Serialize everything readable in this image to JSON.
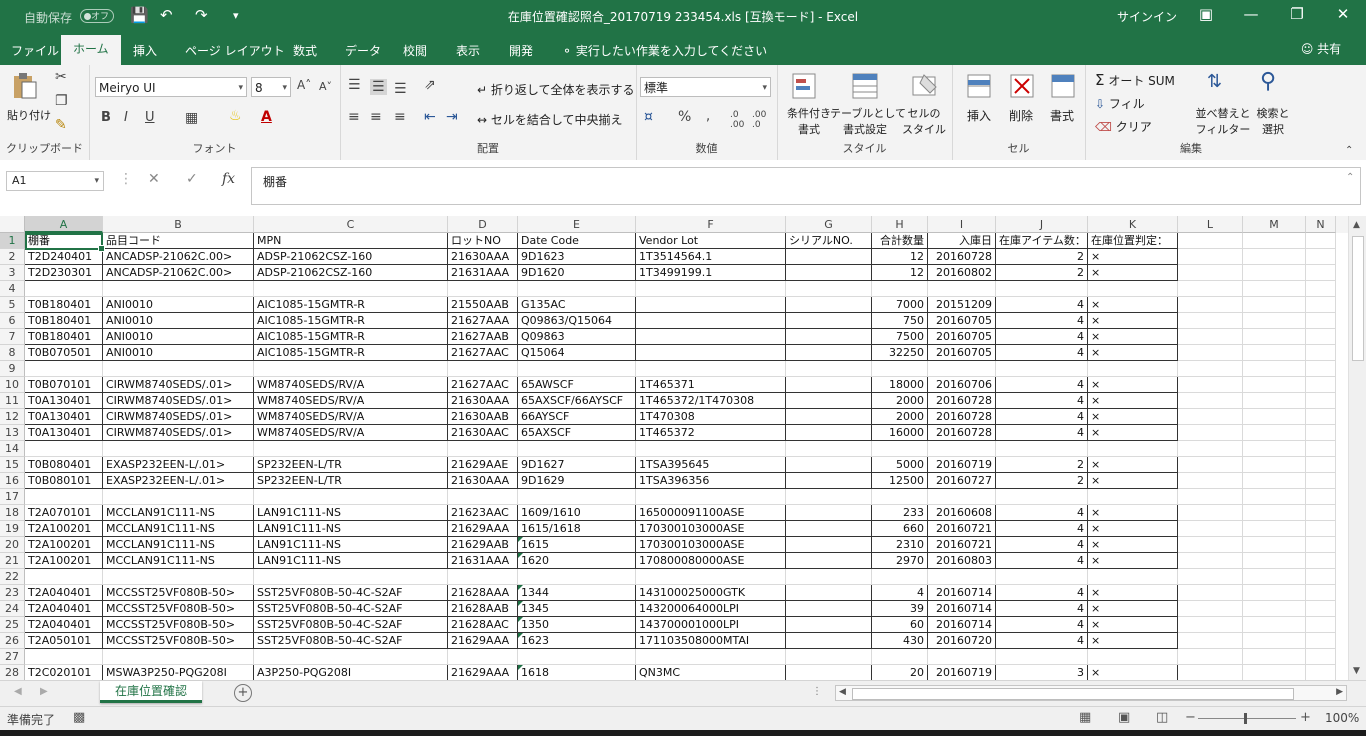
{
  "titlebar": {
    "autosave_label": "自動保存",
    "autosave_state": "オフ",
    "title": "在庫位置確認照合_20170719 233454.xls  [互換モード]  -  Excel",
    "signin": "サインイン",
    "icons": [
      "save-icon",
      "undo-icon",
      "redo-icon",
      "customize-icon",
      "ribbon-display-icon",
      "minimize-icon",
      "restore-icon",
      "close-icon"
    ]
  },
  "ribbon_tabs": {
    "items": [
      "ファイル",
      "ホーム",
      "挿入",
      "ページ レイアウト",
      "数式",
      "データ",
      "校閲",
      "表示",
      "開発"
    ],
    "active": "ホーム",
    "tell_me": "実行したい作業を入力してください",
    "share": "共有"
  },
  "ribbon": {
    "clipboard": {
      "label": "クリップボード",
      "paste": "貼り付け"
    },
    "font": {
      "label": "フォント",
      "name": "Meiryo UI",
      "size": "8"
    },
    "alignment": {
      "label": "配置",
      "wrap": "折り返して全体を表示する",
      "merge": "セルを結合して中央揃え"
    },
    "number": {
      "label": "数値",
      "format": "標準"
    },
    "styles": {
      "label": "スタイル",
      "cond_format": [
        "条件付き",
        "書式"
      ],
      "as_table": [
        "テーブルとして",
        "書式設定"
      ],
      "cell_styles": [
        "セルの",
        "スタイル"
      ]
    },
    "cells": {
      "label": "セル",
      "insert": "挿入",
      "delete": "削除",
      "format": "書式"
    },
    "editing": {
      "label": "編集",
      "autosum": "オート SUM",
      "fill": "フィル",
      "clear": "クリア",
      "sort": [
        "並べ替えと",
        "フィルター"
      ],
      "find": [
        "検索と",
        "選択"
      ]
    }
  },
  "formula_bar": {
    "name_box": "A1",
    "formula": "棚番"
  },
  "columns": [
    "A",
    "B",
    "C",
    "D",
    "E",
    "F",
    "G",
    "H",
    "I",
    "J",
    "K",
    "L",
    "M",
    "N"
  ],
  "rows": [
    {
      "n": "1",
      "c": [
        "棚番",
        "品目コード",
        "MPN",
        "ロットNO",
        "Date Code",
        "Vendor Lot",
        "シリアルNO.",
        "合計数量",
        "入庫日",
        "在庫アイテム数：",
        "在庫位置判定："
      ]
    },
    {
      "n": "2",
      "c": [
        "T2D240401",
        "ANCADSP-21062C.00>",
        "ADSP-21062CSZ-160",
        "21630AAA",
        "9D1623",
        "1T3514564.1",
        "",
        "12",
        "20160728",
        "2",
        "×"
      ]
    },
    {
      "n": "3",
      "c": [
        "T2D230301",
        "ANCADSP-21062C.00>",
        "ADSP-21062CSZ-160",
        "21631AAA",
        "9D1620",
        "1T3499199.1",
        "",
        "12",
        "20160802",
        "2",
        "×"
      ]
    },
    {
      "n": "4",
      "c": []
    },
    {
      "n": "5",
      "c": [
        "T0B180401",
        "ANI0010",
        "AIC1085-15GMTR-R",
        "21550AAB",
        "G135AC",
        "",
        "",
        "7000",
        "20151209",
        "4",
        "×"
      ]
    },
    {
      "n": "6",
      "c": [
        "T0B180401",
        "ANI0010",
        "AIC1085-15GMTR-R",
        "21627AAA",
        "Q09863/Q15064",
        "",
        "",
        "750",
        "20160705",
        "4",
        "×"
      ]
    },
    {
      "n": "7",
      "c": [
        "T0B180401",
        "ANI0010",
        "AIC1085-15GMTR-R",
        "21627AAB",
        "Q09863",
        "",
        "",
        "7500",
        "20160705",
        "4",
        "×"
      ]
    },
    {
      "n": "8",
      "c": [
        "T0B070501",
        "ANI0010",
        "AIC1085-15GMTR-R",
        "21627AAC",
        "Q15064",
        "",
        "",
        "32250",
        "20160705",
        "4",
        "×"
      ]
    },
    {
      "n": "9",
      "c": []
    },
    {
      "n": "10",
      "c": [
        "T0B070101",
        "CIRWM8740SEDS/.01>",
        "WM8740SEDS/RV/A",
        "21627AAC",
        "65AWSCF",
        "1T465371",
        "",
        "18000",
        "20160706",
        "4",
        "×"
      ]
    },
    {
      "n": "11",
      "c": [
        "T0A130401",
        "CIRWM8740SEDS/.01>",
        "WM8740SEDS/RV/A",
        "21630AAA",
        "65AXSCF/66AYSCF",
        "1T465372/1T470308",
        "",
        "2000",
        "20160728",
        "4",
        "×"
      ]
    },
    {
      "n": "12",
      "c": [
        "T0A130401",
        "CIRWM8740SEDS/.01>",
        "WM8740SEDS/RV/A",
        "21630AAB",
        "66AYSCF",
        "1T470308",
        "",
        "2000",
        "20160728",
        "4",
        "×"
      ]
    },
    {
      "n": "13",
      "c": [
        "T0A130401",
        "CIRWM8740SEDS/.01>",
        "WM8740SEDS/RV/A",
        "21630AAC",
        "65AXSCF",
        "1T465372",
        "",
        "16000",
        "20160728",
        "4",
        "×"
      ]
    },
    {
      "n": "14",
      "c": []
    },
    {
      "n": "15",
      "c": [
        "T0B080401",
        "EXASP232EEN-L/.01>",
        "SP232EEN-L/TR",
        "21629AAE",
        "9D1627",
        "1TSA395645",
        "",
        "5000",
        "20160719",
        "2",
        "×"
      ]
    },
    {
      "n": "16",
      "c": [
        "T0B080101",
        "EXASP232EEN-L/.01>",
        "SP232EEN-L/TR",
        "21630AAA",
        "9D1629",
        "1TSA396356",
        "",
        "12500",
        "20160727",
        "2",
        "×"
      ]
    },
    {
      "n": "17",
      "c": []
    },
    {
      "n": "18",
      "c": [
        "T2A070101",
        "MCCLAN91C111-NS",
        "LAN91C111-NS",
        "21623AAC",
        "1609/1610",
        "165000091100ASE",
        "",
        "233",
        "20160608",
        "4",
        "×"
      ]
    },
    {
      "n": "19",
      "c": [
        "T2A100201",
        "MCCLAN91C111-NS",
        "LAN91C111-NS",
        "21629AAA",
        "1615/1618",
        "170300103000ASE",
        "",
        "660",
        "20160721",
        "4",
        "×"
      ]
    },
    {
      "n": "20",
      "c": [
        "T2A100201",
        "MCCLAN91C111-NS",
        "LAN91C111-NS",
        "21629AAB",
        "1615",
        "170300103000ASE",
        "",
        "2310",
        "20160721",
        "4",
        "×"
      ]
    },
    {
      "n": "21",
      "c": [
        "T2A100201",
        "MCCLAN91C111-NS",
        "LAN91C111-NS",
        "21631AAA",
        "1620",
        "170800080000ASE",
        "",
        "2970",
        "20160803",
        "4",
        "×"
      ]
    },
    {
      "n": "22",
      "c": []
    },
    {
      "n": "23",
      "c": [
        "T2A040401",
        "MCCSST25VF080B-50>",
        "SST25VF080B-50-4C-S2AF",
        "21628AAA",
        "1344",
        "143100025000GTK",
        "",
        "4",
        "20160714",
        "4",
        "×"
      ]
    },
    {
      "n": "24",
      "c": [
        "T2A040401",
        "MCCSST25VF080B-50>",
        "SST25VF080B-50-4C-S2AF",
        "21628AAB",
        "1345",
        "143200064000LPI",
        "",
        "39",
        "20160714",
        "4",
        "×"
      ]
    },
    {
      "n": "25",
      "c": [
        "T2A040401",
        "MCCSST25VF080B-50>",
        "SST25VF080B-50-4C-S2AF",
        "21628AAC",
        "1350",
        "143700001000LPI",
        "",
        "60",
        "20160714",
        "4",
        "×"
      ]
    },
    {
      "n": "26",
      "c": [
        "T2A050101",
        "MCCSST25VF080B-50>",
        "SST25VF080B-50-4C-S2AF",
        "21629AAA",
        "1623",
        "171103508000MTAI",
        "",
        "430",
        "20160720",
        "4",
        "×"
      ]
    },
    {
      "n": "27",
      "c": []
    },
    {
      "n": "28",
      "c": [
        "T2C020101",
        "MSWA3P250-PQG208I",
        "A3P250-PQG208I",
        "21629AAA",
        "1618",
        "QN3MC",
        "",
        "20",
        "20160719",
        "3",
        "×"
      ]
    }
  ],
  "sheet_tabs": {
    "active": "在庫位置確認"
  },
  "status": {
    "text": "準備完了",
    "zoom": "100%",
    "zoom_level": 100
  }
}
